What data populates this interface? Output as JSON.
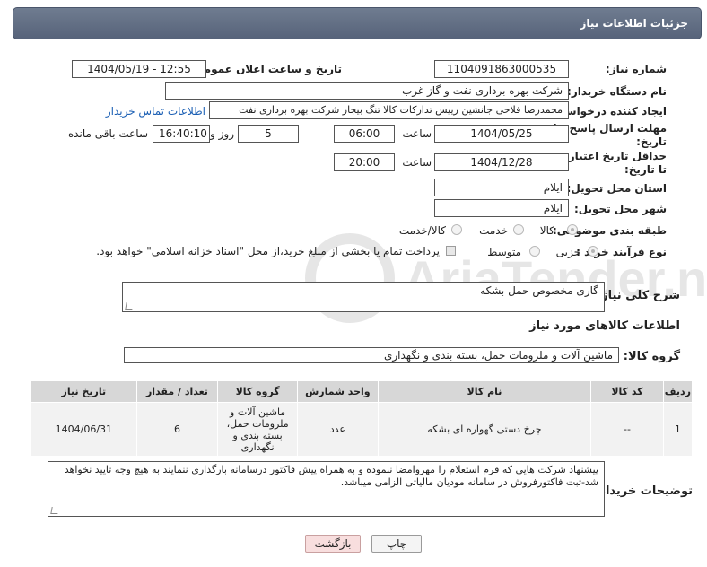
{
  "header": {
    "title": "جزئیات اطلاعات نیاز"
  },
  "need_number": {
    "label": "شماره نیاز:",
    "value": "1104091863000535"
  },
  "announce": {
    "label": "تاریخ و ساعت اعلان عمومی:",
    "value": "1404/05/19 - 12:55"
  },
  "buyer": {
    "label": "نام دستگاه خریدار:",
    "value": "شرکت بهره برداری نفت و گاز غرب"
  },
  "creator": {
    "label": "ایجاد کننده درخواست:",
    "value": "محمدرضا فلاحی جانشین رییس تدارکات کالا تنگ بیجار شرکت بهره برداری نفت",
    "contact_link": "اطلاعات تماس خریدار"
  },
  "deadline": {
    "label_line1": "مهلت ارسال پاسخ: تا",
    "label_line2": "تاریخ:",
    "date": "1404/05/25",
    "time_label": "ساعت",
    "time": "06:00",
    "days": "5",
    "days_label": "روز و",
    "remaining_time": "16:40:10",
    "remaining_label": "ساعت باقی مانده"
  },
  "price_validity": {
    "label_line1": "حداقل تاریخ اعتبار قیمت:",
    "label_line2": "تا تاریخ:",
    "date": "1404/12/28",
    "time_label": "ساعت",
    "time": "20:00"
  },
  "province": {
    "label": "استان محل تحویل:",
    "value": "ایلام"
  },
  "city": {
    "label": "شهر محل تحویل:",
    "value": "ایلام"
  },
  "category": {
    "label": "طبقه بندی موضوعی:",
    "options": [
      "کالا",
      "خدمت",
      "کالا/خدمت"
    ],
    "selected": "کالا"
  },
  "process": {
    "label": "نوع فرآیند خرید :",
    "options": [
      "جزیی",
      "متوسط"
    ],
    "selected": "جزیی",
    "payment_note": "پرداخت تمام یا بخشی از مبلغ خرید،از محل \"اسناد خزانه اسلامی\" خواهد بود."
  },
  "description": {
    "label": "شرح کلی نیاز:",
    "value": "گاری مخصوص حمل بشکه"
  },
  "goods_section": {
    "title": "اطلاعات کالاهای مورد نیاز"
  },
  "goods_group": {
    "label": "گروه کالا:",
    "value": "ماشین آلات و ملزومات حمل، بسته بندی و نگهداری"
  },
  "table": {
    "headers": [
      "ردیف",
      "کد کالا",
      "نام کالا",
      "واحد شمارش",
      "گروه کالا",
      "تعداد / مقدار",
      "تاریخ نیاز"
    ],
    "rows": [
      {
        "index": "1",
        "code": "--",
        "name": "چرخ دستی گهواره ای بشکه",
        "unit": "عدد",
        "group": "ماشین آلات و ملزومات حمل، بسته بندی و نگهداری",
        "qty": "6",
        "date": "1404/06/31"
      }
    ]
  },
  "buyer_notes": {
    "label": "توضیحات خریدار:",
    "value": "پیشنهاد شرکت هایی که فرم استعلام را مهروامضا ننموده و به همراه پیش فاکتور درسامانه بارگذاری ننمایند به هیچ وجه تایید نخواهد شد-ثبت فاکتورفروش در سامانه مودیان مالیاتی الزامی میباشد."
  },
  "buttons": {
    "print": "چاپ",
    "back": "بازگشت"
  },
  "watermark": {
    "text": "AriaTender.net"
  },
  "colors": {
    "header_bg": "#5f6b82",
    "link": "#1b5fb4",
    "back_button_bg": "#f8dede",
    "table_header_bg": "#d7d7d7"
  }
}
